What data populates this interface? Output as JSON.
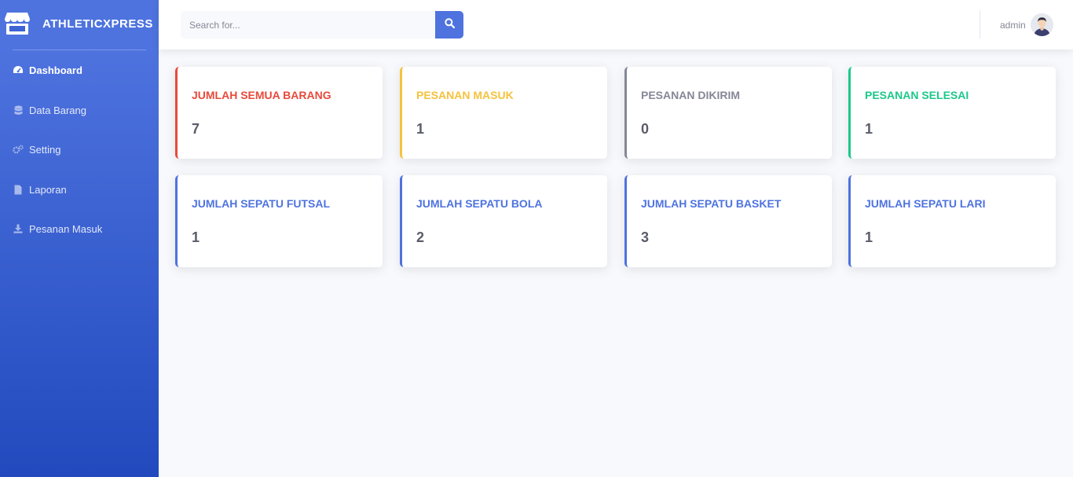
{
  "brand": {
    "name": "ATHLETICXPRESS",
    "icon": "store-icon"
  },
  "sidebar": {
    "items": [
      {
        "label": "Dashboard",
        "icon": "tachometer-icon",
        "active": true
      },
      {
        "label": "Data Barang",
        "icon": "database-icon",
        "active": false
      },
      {
        "label": "Setting",
        "icon": "cogs-icon",
        "active": false
      },
      {
        "label": "Laporan",
        "icon": "file-icon",
        "active": false
      },
      {
        "label": "Pesanan Masuk",
        "icon": "download-icon",
        "active": false
      }
    ]
  },
  "topbar": {
    "search": {
      "placeholder": "Search for...",
      "value": ""
    },
    "user": {
      "name": "admin"
    }
  },
  "colors": {
    "primary": "#4e73df",
    "danger": "#e74a3b",
    "warning": "#f6c23e",
    "secondary": "#858796",
    "success": "#1cc88a"
  },
  "cards": [
    {
      "title": "JUMLAH SEMUA BARANG",
      "value": "7",
      "color": "#e74a3b"
    },
    {
      "title": "PESANAN MASUK",
      "value": "1",
      "color": "#f6c23e"
    },
    {
      "title": "PESANAN DIKIRIM",
      "value": "0",
      "color": "#858796"
    },
    {
      "title": "PESANAN SELESAI",
      "value": "1",
      "color": "#1cc88a"
    },
    {
      "title": "JUMLAH SEPATU FUTSAL",
      "value": "1",
      "color": "#4e73df"
    },
    {
      "title": "JUMLAH SEPATU BOLA",
      "value": "2",
      "color": "#4e73df"
    },
    {
      "title": "JUMLAH SEPATU BASKET",
      "value": "3",
      "color": "#4e73df"
    },
    {
      "title": "JUMLAH SEPATU LARI",
      "value": "1",
      "color": "#4e73df"
    }
  ]
}
